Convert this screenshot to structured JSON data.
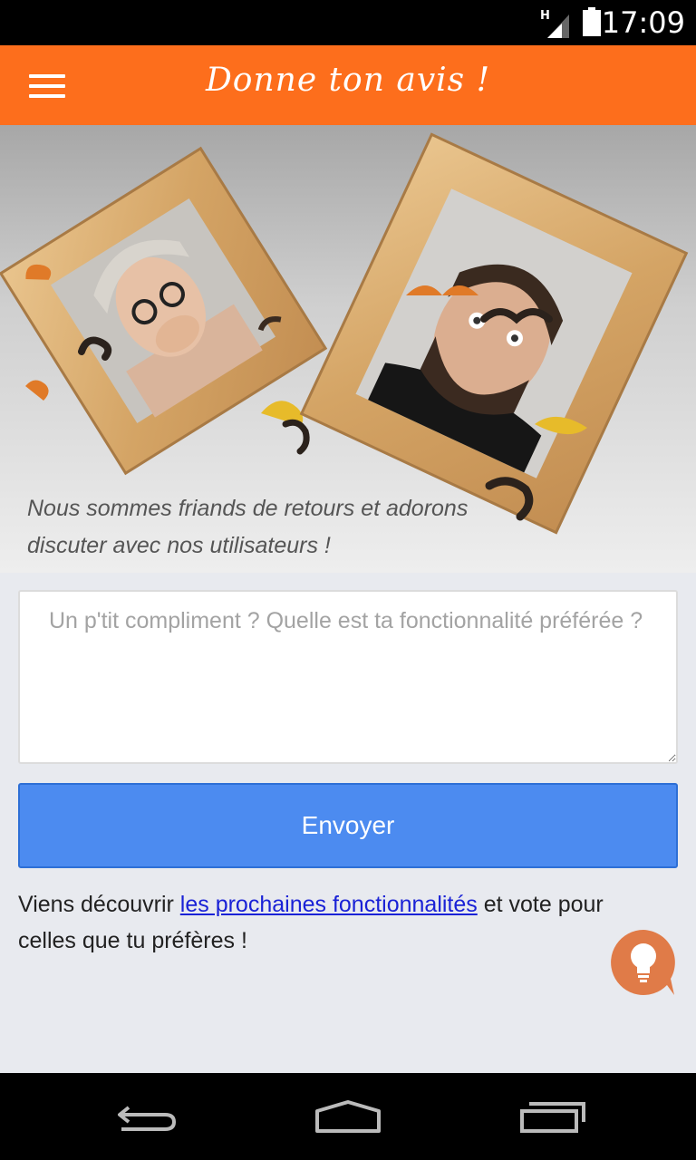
{
  "status_bar": {
    "network_label": "H",
    "time": "17:09",
    "icons": [
      "signal-icon",
      "battery-icon"
    ]
  },
  "app_bar": {
    "title": "Donne ton avis !",
    "menu_icon": "hamburger-menu-icon",
    "color": "#fd6e1c"
  },
  "hero": {
    "caption": "Nous sommes friands de retours et adorons discuter avec nos utilisateurs !"
  },
  "form": {
    "feedback_placeholder": "Un p'tit compliment ? Quelle est ta fonctionnalité préférée ?",
    "feedback_value": "",
    "send_label": "Envoyer",
    "button_color": "#4c8bf0"
  },
  "info": {
    "prefix": "Viens découvrir ",
    "link_text": "les prochaines fonctionnalités",
    "suffix": " et vote pour celles que tu préfères !"
  },
  "fab": {
    "icon": "lightbulb-icon",
    "color": "#e07b48"
  },
  "nav_bar": {
    "icons": [
      "back-icon",
      "home-icon",
      "recents-icon"
    ]
  }
}
